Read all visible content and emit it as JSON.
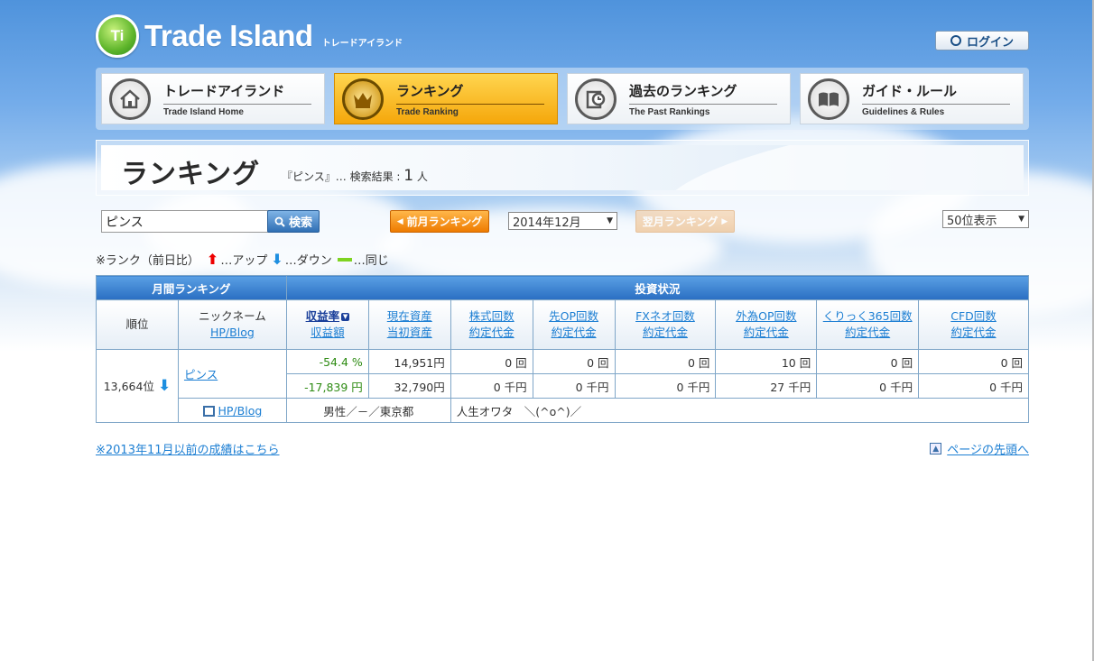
{
  "header": {
    "logo_badge": "Ti",
    "logo_text": "Trade Island",
    "logo_sub": "トレードアイランド",
    "login_label": "ログイン"
  },
  "nav": [
    {
      "label": "トレードアイランド",
      "sub": "Trade Island Home",
      "icon": "home-icon",
      "active": false
    },
    {
      "label": "ランキング",
      "sub": "Trade Ranking",
      "icon": "crown-icon",
      "active": true
    },
    {
      "label": "過去のランキング",
      "sub": "The Past Rankings",
      "icon": "history-icon",
      "active": false
    },
    {
      "label": "ガイド・ルール",
      "sub": "Guidelines & Rules",
      "icon": "book-icon",
      "active": false
    }
  ],
  "banner": {
    "title": "ランキング",
    "result_prefix": "『ピンス』… 検索結果 :",
    "result_count": "1",
    "result_suffix": "人"
  },
  "controls": {
    "search_value": "ピンス",
    "search_label": "検索",
    "prev_label": "前月ランキング",
    "month_selected": "2014年12月",
    "next_label": "翌月ランキング",
    "display_selected": "50位表示"
  },
  "legend": {
    "prefix": "※ランク（前日比）",
    "up": "…アップ",
    "down": "…ダウン",
    "same": "…同じ"
  },
  "table": {
    "group_monthly": "月間ランキング",
    "group_status": "投資状況",
    "col_rank": "順位",
    "col_nick": "ニックネーム",
    "col_nick_link": "HP/Blog",
    "columns": [
      {
        "top": "収益率",
        "bottom": "収益額",
        "active": true
      },
      {
        "top": "現在資産",
        "bottom": "当初資産"
      },
      {
        "top": "株式回数",
        "bottom": "約定代金"
      },
      {
        "top": "先OP回数",
        "bottom": "約定代金"
      },
      {
        "top": "FXネオ回数",
        "bottom": "約定代金"
      },
      {
        "top": "外為OP回数",
        "bottom": "約定代金"
      },
      {
        "top": "くりっく365回数",
        "bottom": "約定代金"
      },
      {
        "top": "CFD回数",
        "bottom": "約定代金"
      }
    ],
    "row": {
      "rank": "13,664位",
      "nickname": "ピンス",
      "line1": [
        "-54.4 %",
        "14,951円",
        "0 回",
        "0 回",
        "0 回",
        "10 回",
        "0 回",
        "0 回"
      ],
      "line2": [
        "-17,839 円",
        "32,790円",
        "0 千円",
        "0 千円",
        "0 千円",
        "27 千円",
        "0 千円",
        "0 千円"
      ],
      "blog_link": "HP/Blog",
      "profile": "男性／－／東京都",
      "comment": "人生オワタ　＼(^o^)／"
    }
  },
  "footer": {
    "old_results": "※2013年11月以前の成績はこちら",
    "to_top": "ページの先頭へ"
  }
}
